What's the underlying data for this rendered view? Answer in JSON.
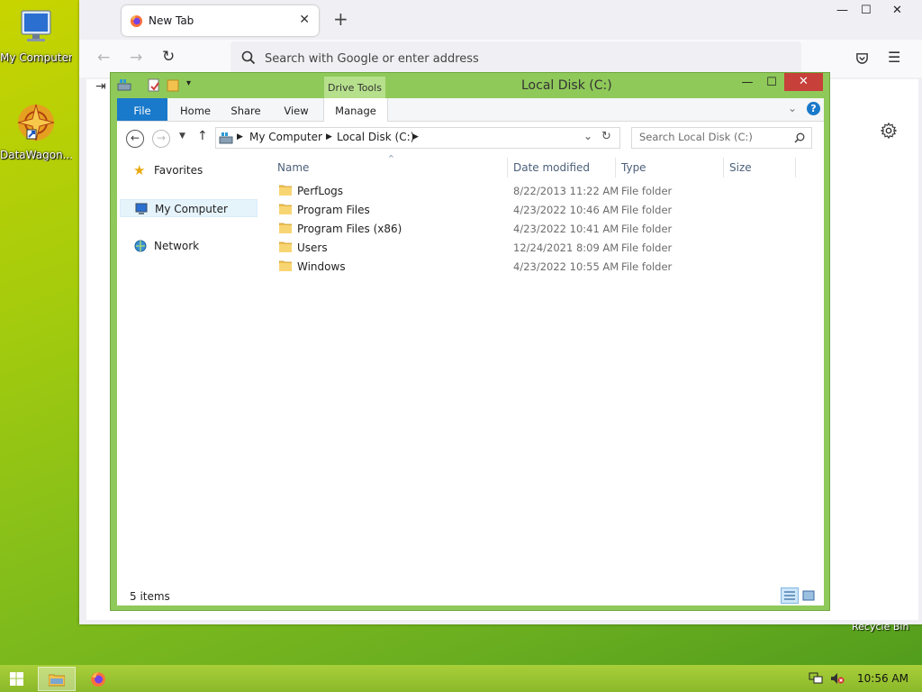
{
  "desktop": {
    "icons": [
      {
        "label": "My Computer"
      },
      {
        "label": "DataWagon..."
      }
    ],
    "recycle_bin_label": "Recycle Bin"
  },
  "browser": {
    "tab_title": "New Tab",
    "new_tab_symbol": "+",
    "address_placeholder": "Search with Google or enter address"
  },
  "explorer": {
    "title": "Local Disk (C:)",
    "context_tab_group": "Drive Tools",
    "ribbon_tabs": [
      "File",
      "Home",
      "Share",
      "View",
      "Manage"
    ],
    "breadcrumb": [
      "My Computer",
      "Local Disk (C:)"
    ],
    "search_placeholder": "Search Local Disk (C:)",
    "nav_pane": {
      "favorites": "Favorites",
      "my_computer": "My Computer",
      "network": "Network"
    },
    "columns": [
      "Name",
      "Date modified",
      "Type",
      "Size"
    ],
    "rows": [
      {
        "name": "PerfLogs",
        "date": "8/22/2013 11:22 AM",
        "type": "File folder"
      },
      {
        "name": "Program Files",
        "date": "4/23/2022 10:46 AM",
        "type": "File folder"
      },
      {
        "name": "Program Files (x86)",
        "date": "4/23/2022 10:41 AM",
        "type": "File folder"
      },
      {
        "name": "Users",
        "date": "12/24/2021 8:09 AM",
        "type": "File folder"
      },
      {
        "name": "Windows",
        "date": "4/23/2022 10:55 AM",
        "type": "File folder"
      }
    ],
    "status": "5 items"
  },
  "taskbar": {
    "clock": "10:56 AM"
  },
  "colors": {
    "explorer_frame": "#8fc95a",
    "file_tab": "#1979ca",
    "close_button": "#c7403a",
    "taskbar": "#9ac532"
  }
}
